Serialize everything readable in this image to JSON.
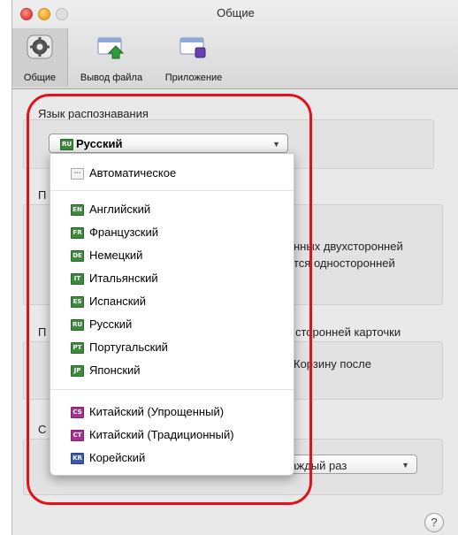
{
  "window": {
    "title": "Общие"
  },
  "toolbar": {
    "general_label": "Общие",
    "output_label": "Вывод файла",
    "app_label": "Приложение"
  },
  "language_section": {
    "label": "Язык распознавания",
    "selected": "Русский",
    "selected_code": "RU"
  },
  "menu": {
    "automatic": "Автоматическое",
    "items": [
      {
        "code": "EN",
        "label": "Английский",
        "color": "#3c8a3c"
      },
      {
        "code": "FR",
        "label": "Французский",
        "color": "#3c8a3c"
      },
      {
        "code": "DE",
        "label": "Немецкий",
        "color": "#3c8a3c"
      },
      {
        "code": "IT",
        "label": "Итальянский",
        "color": "#3c8a3c"
      },
      {
        "code": "ES",
        "label": "Испанский",
        "color": "#3c8a3c"
      },
      {
        "code": "RU",
        "label": "Русский",
        "color": "#3c8a3c"
      },
      {
        "code": "PT",
        "label": "Португальский",
        "color": "#3c8a3c"
      },
      {
        "code": "JP",
        "label": "Японский",
        "color": "#3c8a3c"
      },
      {
        "code": "CS",
        "label": "Китайский (Упрощенный)",
        "color": "#a2338f"
      },
      {
        "code": "CT",
        "label": "Китайский (Традиционный)",
        "color": "#a2338f"
      },
      {
        "code": "KR",
        "label": "Корейский",
        "color": "#3b5aa8"
      }
    ]
  },
  "background": {
    "section2_prefix": "П",
    "section2_line1": "нных двухсторонней",
    "section2_line2": "тся односторонней",
    "section3_prefix": "П",
    "section3_suffix": "сторонней карточки",
    "section3_line1": "Корзину после",
    "section4_prefix": "С",
    "select_value": "ыбрать каждый раз"
  },
  "help": {
    "label": "?"
  }
}
